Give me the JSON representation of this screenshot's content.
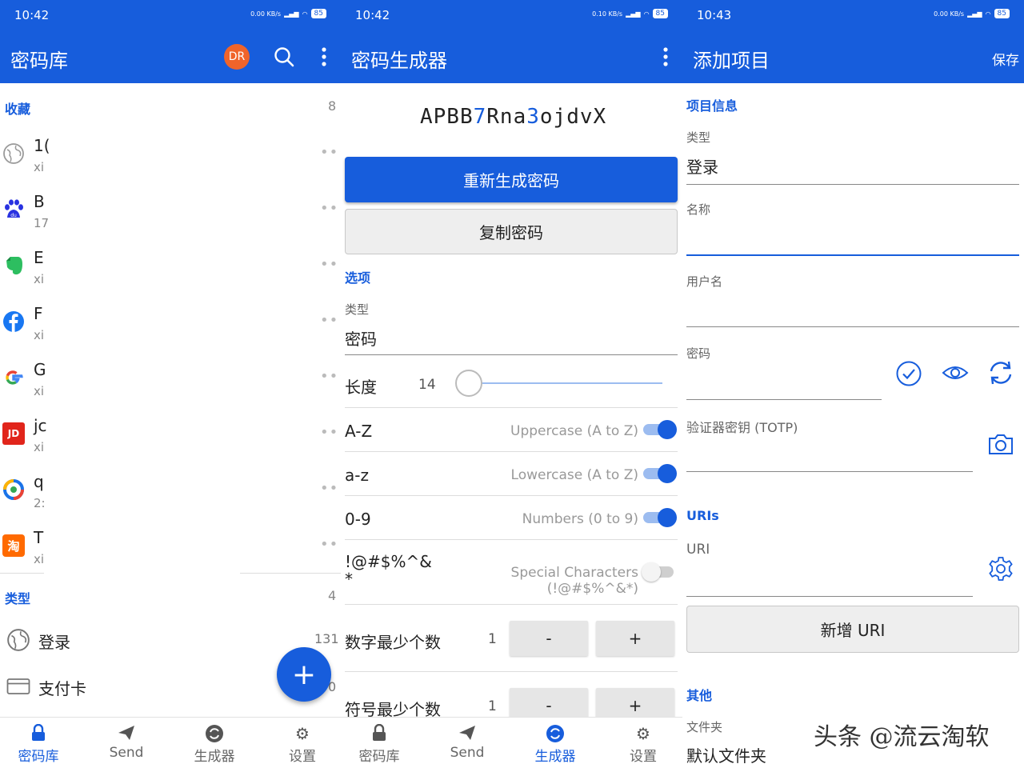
{
  "colors": {
    "primary": "#175ddc",
    "dr_avatar": "#f0642a"
  },
  "vault": {
    "status": {
      "time": "10:42",
      "speed": "0.00 KB/s",
      "battery": "85"
    },
    "title": "密码库",
    "avatar": "DR",
    "favorites": {
      "title": "收藏",
      "count": "8"
    },
    "items": [
      {
        "name": "1(",
        "sub": "xi",
        "icon": "globe-icon"
      },
      {
        "name": "B",
        "sub": "17",
        "icon": "baidu-icon"
      },
      {
        "name": "E",
        "sub": "xi",
        "icon": "evernote-icon"
      },
      {
        "name": "F",
        "sub": "xi",
        "icon": "facebook-icon"
      },
      {
        "name": "G",
        "sub": "xi",
        "icon": "google-icon"
      },
      {
        "name": "jc",
        "sub": "xi",
        "icon": "jd-icon"
      },
      {
        "name": "q",
        "sub": "2:",
        "icon": "qq-browser-icon"
      },
      {
        "name": "T",
        "sub": "xi",
        "icon": "taobao-icon"
      }
    ],
    "types": {
      "title": "类型",
      "count": "4",
      "list": [
        {
          "label": "登录",
          "count": "131",
          "icon": "globe-icon"
        },
        {
          "label": "支付卡",
          "count": "0",
          "icon": "card-icon"
        }
      ]
    },
    "nav": [
      {
        "label": "密码库",
        "icon": "lock-icon",
        "active": true
      },
      {
        "label": "Send",
        "icon": "send-icon",
        "active": false
      },
      {
        "label": "生成器",
        "icon": "refresh-icon",
        "active": false
      },
      {
        "label": "设置",
        "icon": "gear-icon",
        "active": false
      }
    ]
  },
  "generator": {
    "status": {
      "time": "10:42",
      "speed": "0.10 KB/s",
      "battery": "85"
    },
    "title": "密码生成器",
    "password_parts": [
      "APBB",
      "7",
      "Rna",
      "3",
      "ojdvX"
    ],
    "regenerate": "重新生成密码",
    "copy": "复制密码",
    "options_title": "选项",
    "type_label": "类型",
    "type_value": "密码",
    "length_label": "长度",
    "length_value": "14",
    "options": [
      {
        "left": "A-Z",
        "right": "Uppercase (A to Z)",
        "on": true
      },
      {
        "left": "a-z",
        "right": "Lowercase (A to Z)",
        "on": true
      },
      {
        "left": "0-9",
        "right": "Numbers (0 to 9)",
        "on": true
      },
      {
        "left": "!@#$%^&\n*",
        "right": "Special Characters (!@#$%^&*)",
        "on": false
      }
    ],
    "min_numbers_label": "数字最少个数",
    "min_numbers_value": "1",
    "min_special_label": "符号最少个数",
    "min_special_value": "1",
    "minus": "-",
    "plus": "+",
    "nav": [
      {
        "label": "密码库",
        "icon": "lock-icon",
        "active": false
      },
      {
        "label": "Send",
        "icon": "send-icon",
        "active": false
      },
      {
        "label": "生成器",
        "icon": "refresh-icon",
        "active": true
      },
      {
        "label": "设置",
        "icon": "gear-icon",
        "active": false
      }
    ]
  },
  "add_item": {
    "status": {
      "time": "10:43",
      "speed": "0.00 KB/s",
      "battery": "85"
    },
    "title": "添加项目",
    "save": "保存",
    "item_info": "项目信息",
    "type_label": "类型",
    "type_value": "登录",
    "name_label": "名称",
    "username_label": "用户名",
    "password_label": "密码",
    "totp_label": "验证器密钥 (TOTP)",
    "uris_title": "URIs",
    "uri_label": "URI",
    "new_uri": "新增 URI",
    "other_title": "其他",
    "folder_label": "文件夹",
    "folder_value": "默认文件夹",
    "watermark": "头条 @流云淘软"
  }
}
